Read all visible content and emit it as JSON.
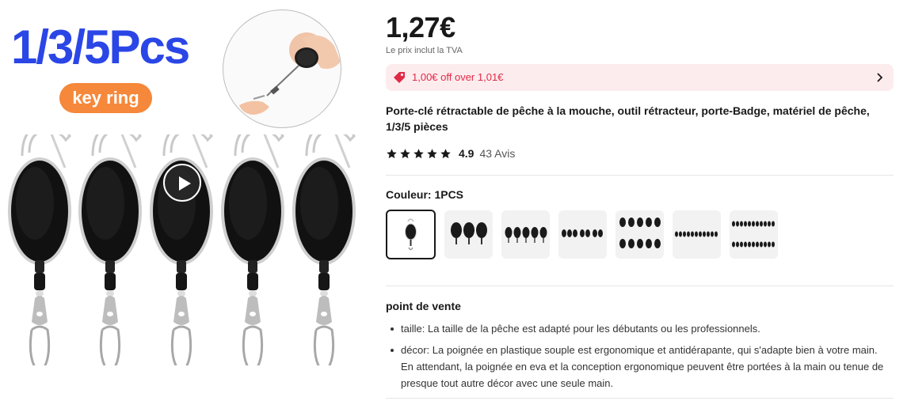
{
  "image": {
    "headline": "1/3/5Pcs",
    "badge": "key ring"
  },
  "product": {
    "price": "1,27€",
    "vat_note": "Le prix inclut la TVA",
    "coupon": "1,00€ off over 1,01€",
    "title": "Porte-clé rétractable de pêche à la mouche, outil rétracteur, porte-Badge, matériel de pêche, 1/3/5 pièces",
    "rating": "4.9",
    "rating_stars": 5,
    "reviews": "43 Avis"
  },
  "options": {
    "color_label": "Couleur: 1PCS",
    "swatches": [
      {
        "name": "1PCS",
        "selected": true
      },
      {
        "name": "3PCS"
      },
      {
        "name": "5PCS"
      },
      {
        "name": "option-4"
      },
      {
        "name": "option-5"
      },
      {
        "name": "option-6"
      },
      {
        "name": "option-7"
      }
    ]
  },
  "selling_points": {
    "title": "point de vente",
    "items": [
      "taille: La taille de la pêche est adapté pour les débutants ou les professionnels.",
      "décor: La poignée en plastique souple est ergonomique et antidérapante, qui s'adapte bien à votre main. En attendant, la poignée en eva et la conception ergonomique peuvent être portées à la main ou tenue de presque tout autre décor avec une seule main."
    ]
  },
  "colors": {
    "headline_blue": "#2b46e6",
    "badge_orange": "#f5883a",
    "coupon_red": "#e02a48",
    "coupon_bg": "#fdecee"
  }
}
